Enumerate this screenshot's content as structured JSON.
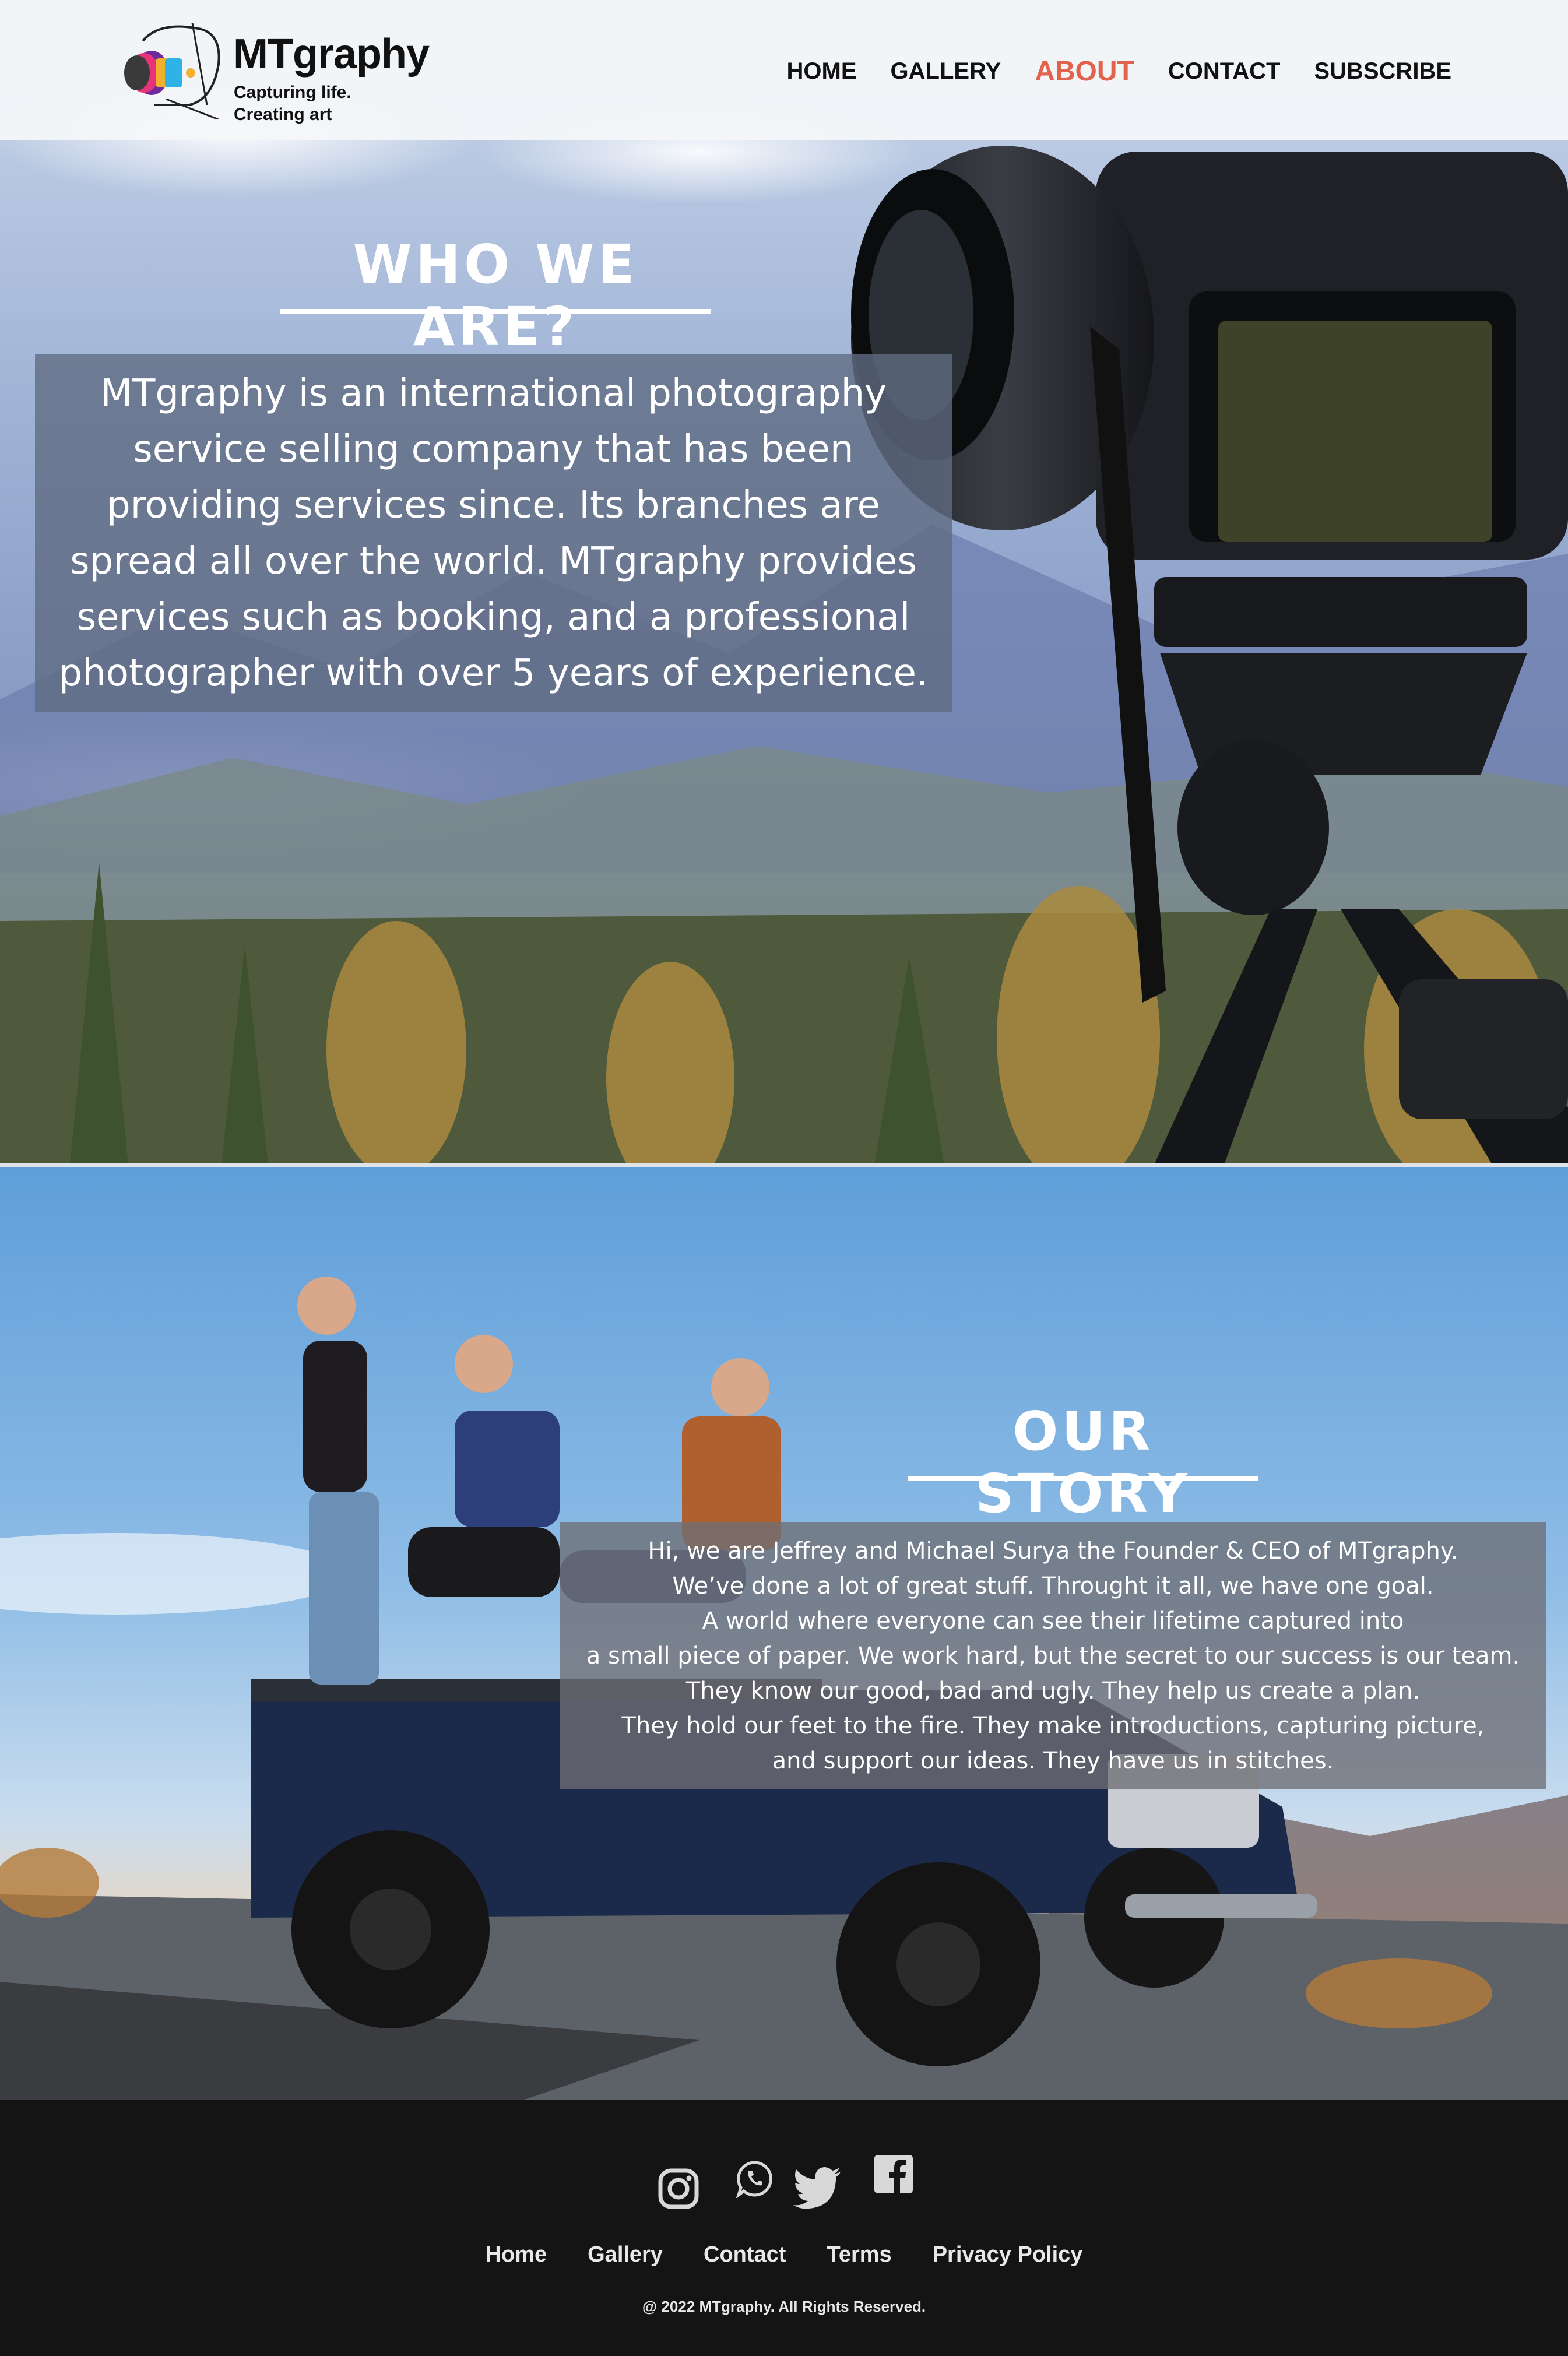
{
  "brand": {
    "name": "MTgraphy",
    "tagline_line1": "Capturing life.",
    "tagline_line2": "Creating art"
  },
  "nav": {
    "items": [
      {
        "label": "HOME",
        "active": false
      },
      {
        "label": "GALLERY",
        "active": false
      },
      {
        "label": "ABOUT",
        "active": true
      },
      {
        "label": "CONTACT",
        "active": false
      },
      {
        "label": "SUBSCRIBE",
        "active": false
      }
    ]
  },
  "who": {
    "title": "WHO WE ARE?",
    "text": "MTgraphy is an international photography service selling company that has been providing services since. Its branches are spread all over the world. MTgraphy provides services such as booking, and a professional photographer with over 5 years of experience."
  },
  "story": {
    "title": "OUR STORY",
    "lines": [
      "Hi, we are Jeffrey and Michael Surya the Founder & CEO of MTgraphy.",
      "We’ve done a lot of great stuff. Throught it all, we have one goal.",
      "A world where everyone can see their lifetime captured into",
      "a small piece of paper. We work hard, but the secret to our success is our team.",
      "They know our good, bad and ugly. They help us create a plan.",
      "They hold our feet to the fire. They make introductions, capturing picture,",
      "and support our ideas. They have us in stitches."
    ]
  },
  "footer": {
    "social": [
      "instagram-icon",
      "whatsapp-icon",
      "twitter-icon",
      "facebook-icon"
    ],
    "links": [
      "Home",
      "Gallery",
      "Contact",
      "Terms",
      "Privacy Policy"
    ],
    "copyright": "@ 2022 MTgraphy. All Rights Reserved."
  },
  "colors": {
    "accent": "#e2634b",
    "footer_bg": "#141414"
  }
}
